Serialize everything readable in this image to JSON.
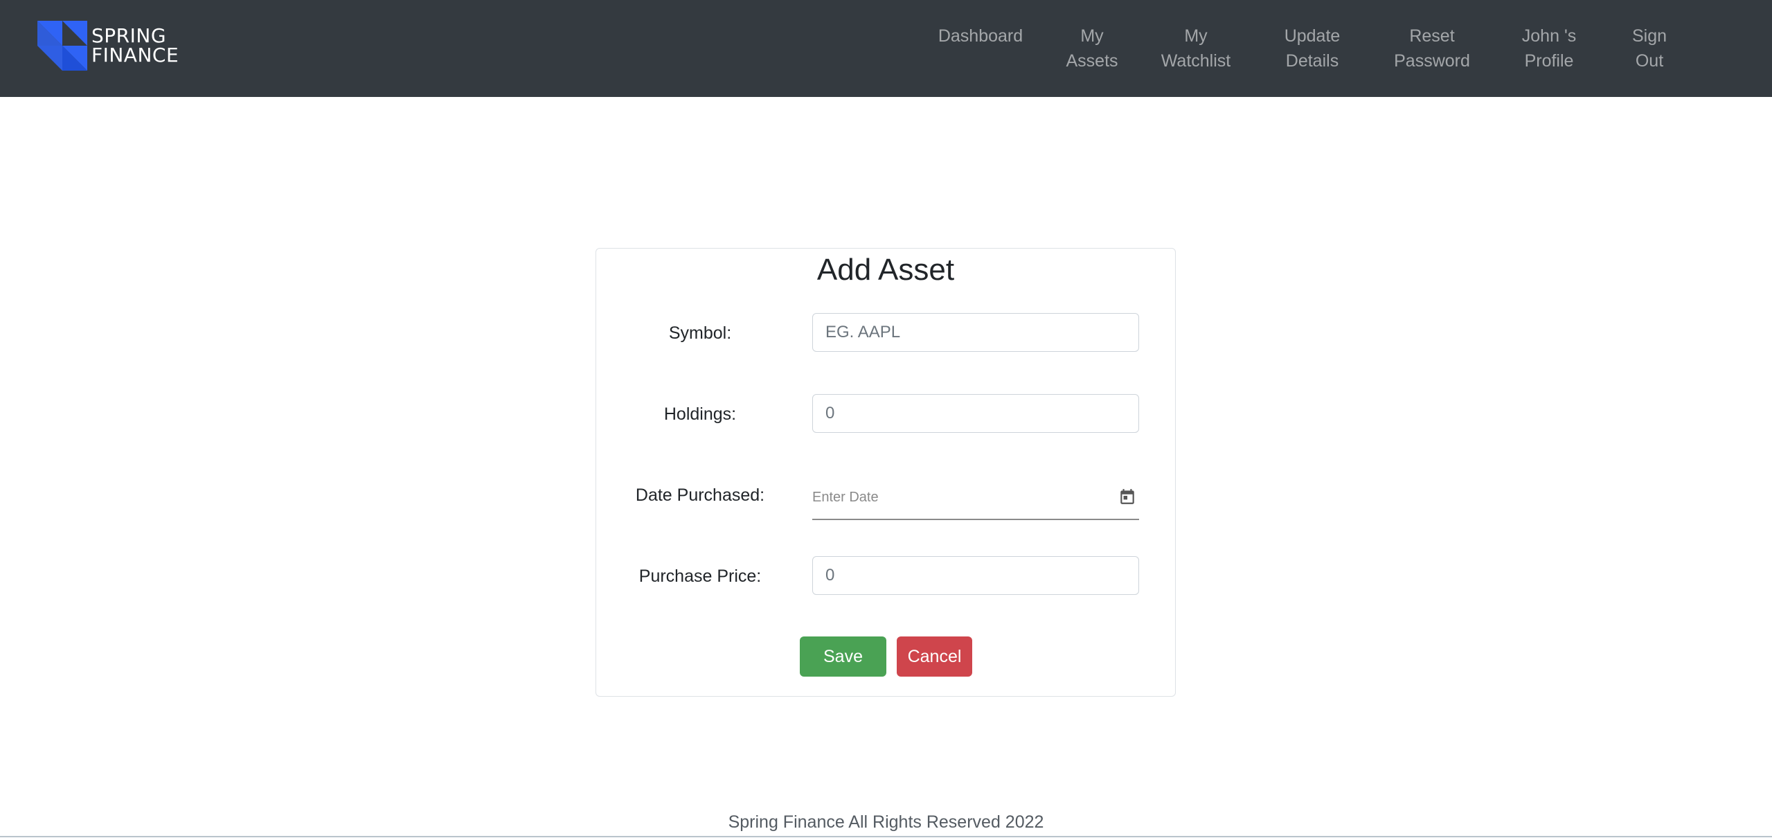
{
  "brand": {
    "line1": "SPRING",
    "line2": "FINANCE",
    "accent_color": "#2f63f5"
  },
  "nav": {
    "items": [
      {
        "label": "Dashboard"
      },
      {
        "label": "My\nAssets"
      },
      {
        "label": "My\nWatchlist"
      },
      {
        "label": "Update\nDetails"
      },
      {
        "label": "Reset\nPassword"
      },
      {
        "label": "John 's\nProfile"
      },
      {
        "label": "Sign\nOut"
      }
    ]
  },
  "form": {
    "title": "Add Asset",
    "symbol": {
      "label": "Symbol:",
      "placeholder": "EG. AAPL",
      "value": ""
    },
    "holdings": {
      "label": "Holdings:",
      "placeholder": "0",
      "value": ""
    },
    "date_purchased": {
      "label": "Date Purchased:",
      "placeholder": "Enter Date",
      "value": "",
      "icon": "calendar-icon"
    },
    "purchase_price": {
      "label": "Purchase Price:",
      "placeholder": "0",
      "value": ""
    },
    "save_label": "Save",
    "cancel_label": "Cancel"
  },
  "colors": {
    "navbar": "#343a40",
    "save": "#4aa254",
    "cancel": "#cf454c"
  },
  "footer": {
    "text": "Spring Finance All Rights Reserved 2022"
  }
}
